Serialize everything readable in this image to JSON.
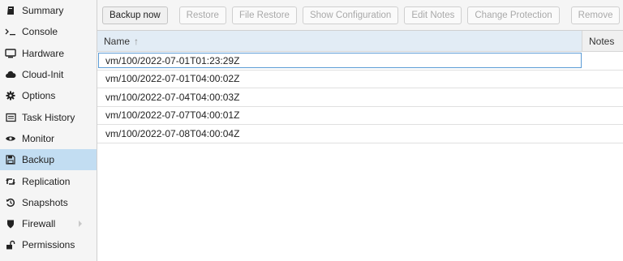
{
  "sidebar": {
    "items": [
      {
        "label": "Summary",
        "icon": "summary-icon"
      },
      {
        "label": "Console",
        "icon": "console-icon"
      },
      {
        "label": "Hardware",
        "icon": "monitor-icon"
      },
      {
        "label": "Cloud-Init",
        "icon": "cloud-icon"
      },
      {
        "label": "Options",
        "icon": "gear-icon"
      },
      {
        "label": "Task History",
        "icon": "list-icon"
      },
      {
        "label": "Monitor",
        "icon": "eye-icon"
      },
      {
        "label": "Backup",
        "icon": "floppy-icon"
      },
      {
        "label": "Replication",
        "icon": "retweet-icon"
      },
      {
        "label": "Snapshots",
        "icon": "history-icon"
      },
      {
        "label": "Firewall",
        "icon": "shield-icon"
      },
      {
        "label": "Permissions",
        "icon": "unlock-icon"
      }
    ],
    "active": "Backup"
  },
  "toolbar": {
    "backup_now": "Backup now",
    "restore": "Restore",
    "file_restore": "File Restore",
    "show_configuration": "Show Configuration",
    "edit_notes": "Edit Notes",
    "change_protection": "Change Protection",
    "remove": "Remove"
  },
  "grid": {
    "columns": {
      "name": "Name",
      "notes": "Notes"
    },
    "sort_icon": "arrow-up-icon",
    "rows": [
      "vm/100/2022-07-01T01:23:29Z",
      "vm/100/2022-07-01T04:00:02Z",
      "vm/100/2022-07-04T04:00:03Z",
      "vm/100/2022-07-07T04:00:01Z",
      "vm/100/2022-07-08T04:00:04Z"
    ]
  },
  "colors": {
    "active_bg": "#c2ddf2",
    "focus_border": "#5b9bd5"
  }
}
